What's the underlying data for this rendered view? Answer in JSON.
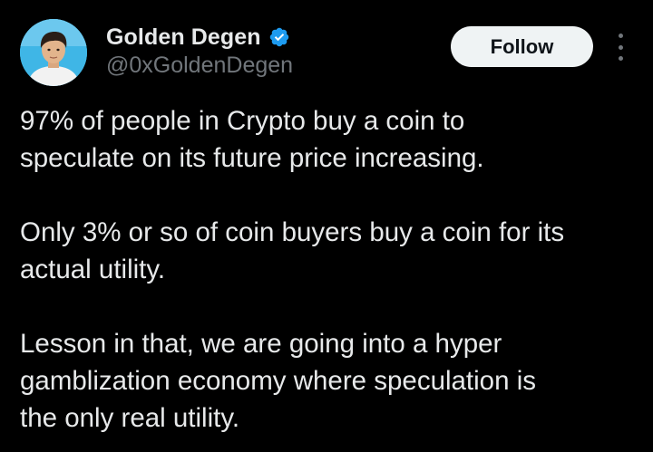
{
  "author": {
    "display_name": "Golden Degen",
    "handle": "@0xGoldenDegen",
    "verified": true,
    "avatar_icon": "profile-photo",
    "verified_icon": "verified-badge-icon"
  },
  "actions": {
    "follow_label": "Follow",
    "more_icon": "more-options-icon"
  },
  "tweet": {
    "paragraphs": [
      "97% of people in Crypto buy a coin to\nspeculate on its future price increasing.",
      "Only 3% or so of coin buyers buy a coin for its\nactual utility.",
      "Lesson in that, we are going into a hyper\ngamblization economy where speculation is\nthe only real utility."
    ]
  },
  "colors": {
    "background": "#000000",
    "text_primary": "#e7e9ea",
    "text_secondary": "#71767b",
    "verified_blue": "#1d9bf0",
    "follow_bg": "#eff3f4",
    "follow_text": "#0f1419"
  }
}
